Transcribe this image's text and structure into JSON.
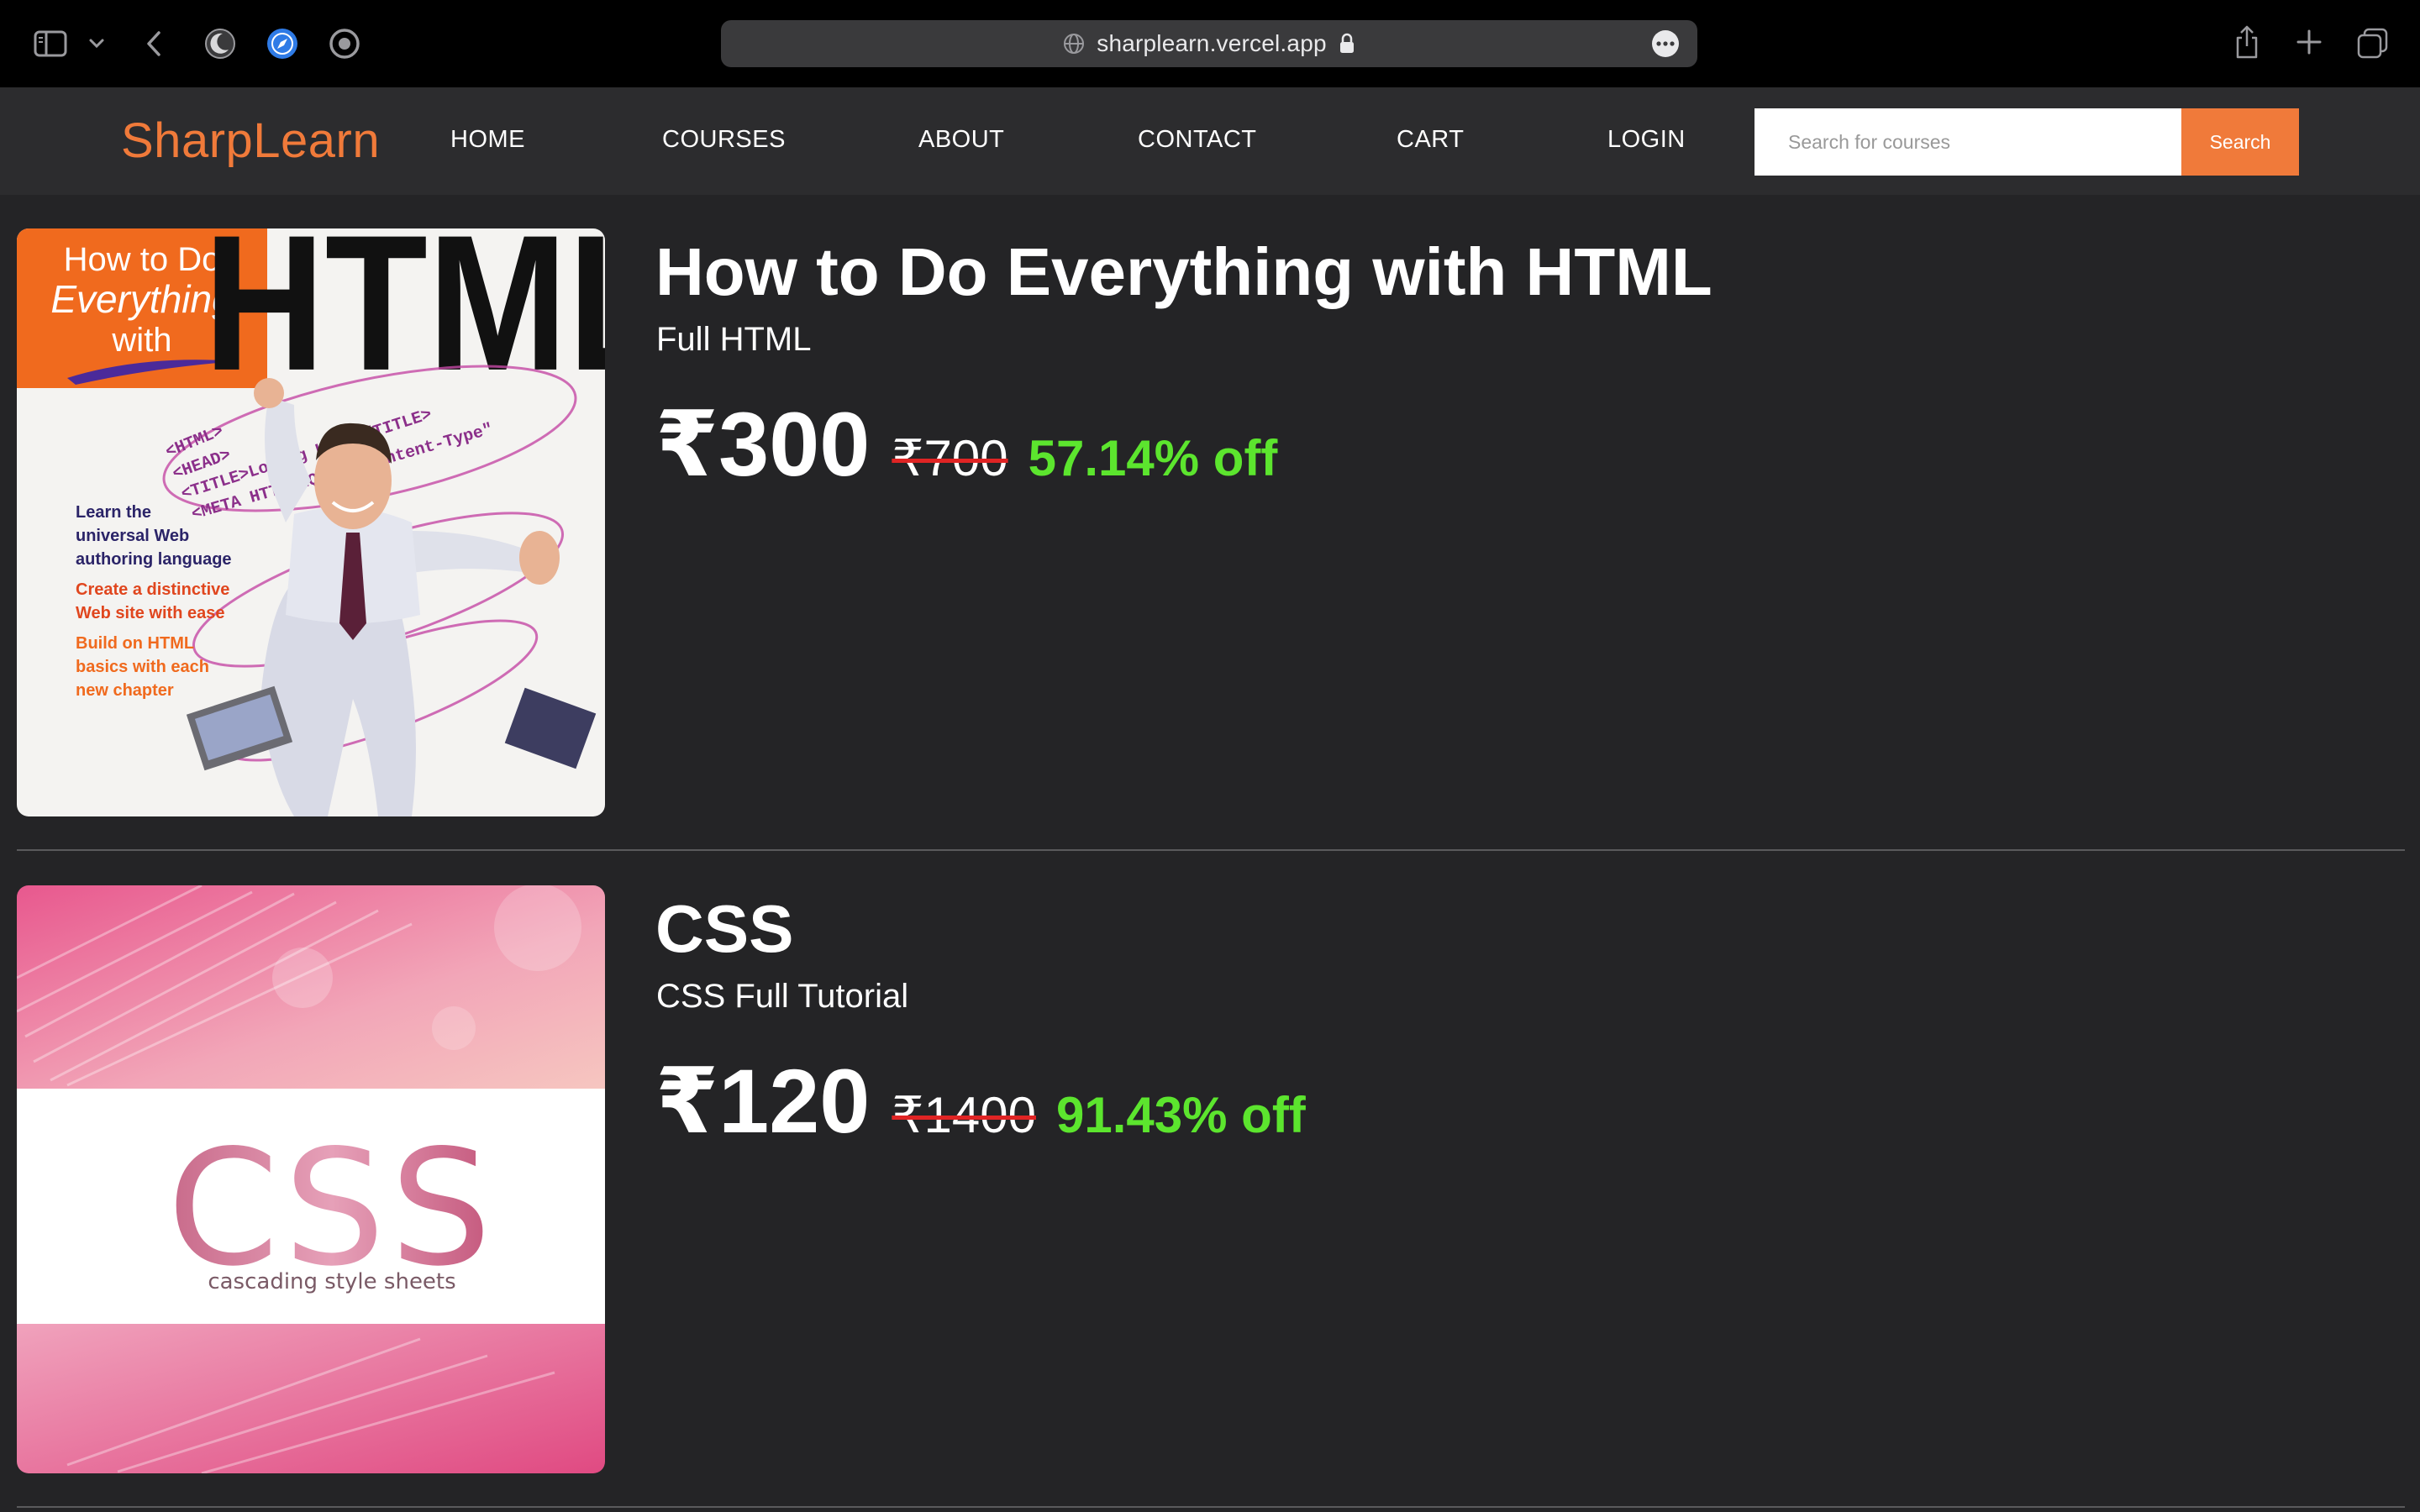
{
  "browser": {
    "url": "sharplearn.vercel.app"
  },
  "navbar": {
    "brand": "SharpLearn",
    "links": [
      "HOME",
      "COURSES",
      "ABOUT",
      "CONTACT",
      "CART",
      "LOGIN"
    ],
    "search_placeholder": "Search for courses",
    "search_button": "Search"
  },
  "courses": [
    {
      "title": "How to Do Everything with HTML",
      "subtitle": "Full HTML",
      "price": "₹300",
      "original_price": "₹700",
      "discount": "57.14% off",
      "cover": {
        "banner_lines": [
          "How to Do",
          "Everything",
          "with"
        ],
        "big_word": "HTML",
        "blurbs": [
          "Learn the",
          "universal Web",
          "authoring language",
          "Create a distinctive",
          "Web site with ease",
          "Build on HTML",
          "basics with each",
          "new chapter"
        ],
        "tags": [
          "<HTML>",
          "<HEAD>",
          "<TITLE>Loving HTML</TITLE>",
          "<META HTTP-EQUIV=\"Content-Type\""
        ]
      }
    },
    {
      "title": "CSS",
      "subtitle": "CSS Full Tutorial",
      "price": "₹120",
      "original_price": "₹1400",
      "discount": "91.43% off",
      "cover": {
        "big_word": "CSS",
        "tagline": "cascading style sheets"
      }
    }
  ],
  "colors": {
    "accent": "#f07a3a",
    "discount": "#5ce52e",
    "strike": "#e02424",
    "background": "#242426",
    "navbar": "#2c2c2e"
  }
}
